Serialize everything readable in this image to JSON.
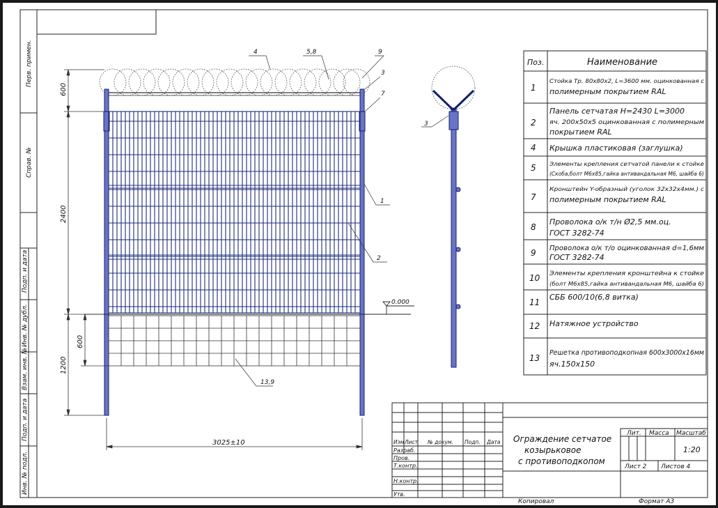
{
  "stamp": {
    "side_labels": [
      "Перв. примен.",
      "Справ. №",
      "Подп. и дата",
      "Инв. № дубл.",
      "Взам. инв. №",
      "Подп. и дата",
      "Инв. № подл."
    ],
    "title_lines": [
      "Ограждение сетчатое",
      "козырьковое",
      "с противоподкопом"
    ],
    "header": [
      "Изм",
      "Лист",
      "№ докум.",
      "Подп.",
      "Дата"
    ],
    "roles": [
      "Разраб.",
      "Пров.",
      "Т.контр.",
      "",
      "Н.контр.",
      "Утв."
    ],
    "lit_label": "Лит.",
    "mass_label": "Масса",
    "scale_label": "Масштаб",
    "scale_value": "1:20",
    "sheet_text": "Лист  2",
    "sheets_text": "Листов  4",
    "copied": "Копировал",
    "format": "Формат   А3"
  },
  "spec": {
    "header_pos": "Поз.",
    "header_name": "Наименование",
    "rows": [
      {
        "pos": "1",
        "l1": "Стойка  Тр. 80х80х2, L=3600 мм. оцинкованная с",
        "l2": "полимерным покрытием RAL"
      },
      {
        "pos": "2",
        "l1": "Панель сетчатая  H=2430  L=3000",
        "l2": "яч. 200х50х5 оцинкованная с полимерным",
        "l3": "покрытием RAL"
      },
      {
        "pos": "4",
        "l1": "Крышка пластиковая (заглушка)"
      },
      {
        "pos": "5",
        "l1": "Элементы крепления сетчатой панели к стойке",
        "l2": "(Скоба,болт М6х85,гайка антивандальная М6, шайба 6)"
      },
      {
        "pos": "7",
        "l1": "Кронштейн Y-образный (уголок 32х32х4мм.) с",
        "l2": "полимерным покрытием RAL"
      },
      {
        "pos": "8",
        "l1": "Проволока о/к т/н Ø2,5 мм.оц.",
        "l2": "ГОСТ 3282-74"
      },
      {
        "pos": "9",
        "l1": "Проволока о/к т/о оцинкованная d=1,6мм",
        "l2": "ГОСТ 3282-74"
      },
      {
        "pos": "10",
        "l1": "Элементы крепления кронштейна к стойке",
        "l2": "(болт М6х85,гайка антивандальная М6, шайба 6)"
      },
      {
        "pos": "11",
        "l1": "СББ 600/10(6,8 витка)"
      },
      {
        "pos": "12",
        "l1": "Натяжное устройство"
      },
      {
        "pos": "13",
        "l1": "Решетка противоподкопная 600х3000х16мм",
        "l2": "яч.150х150"
      }
    ]
  },
  "drawing": {
    "dim_600_top": "600",
    "dim_2400": "2400",
    "dim_600_bottom": "600",
    "dim_1200": "1200",
    "dim_width": "3025±10",
    "level": "0.000",
    "callout_4": "4",
    "callout_58": "5,8",
    "callout_9": "9",
    "callout_3": "3",
    "callout_7": "7",
    "callout_1": "1",
    "callout_2": "2",
    "callout_139": "13,9",
    "callout_3_side": "3"
  },
  "colors": {
    "frame_bg": "#1a1a1a",
    "paper": "#ffffff",
    "mesh": "#1c2c7a",
    "post_fill": "#6a74c4"
  }
}
